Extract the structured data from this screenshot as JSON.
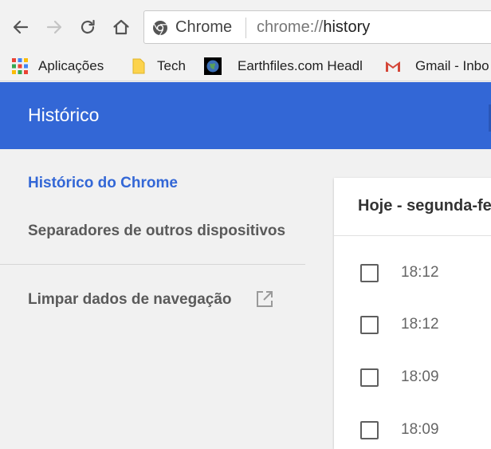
{
  "toolbar": {
    "back_icon": "arrow-left-icon",
    "forward_icon": "arrow-right-icon",
    "reload_icon": "reload-icon",
    "home_icon": "home-icon",
    "omnibox": {
      "site_chip": "Chrome",
      "url_scheme": "chrome://",
      "url_host": "history"
    }
  },
  "bookmarks": {
    "items": [
      {
        "label": "Aplicações",
        "icon": "apps-grid-icon"
      },
      {
        "label": "Tech",
        "icon": "folder-icon"
      },
      {
        "label": "Earthfiles.com Headl",
        "icon": "earth-icon"
      },
      {
        "label": "Gmail - Inbo",
        "icon": "gmail-icon"
      }
    ]
  },
  "header": {
    "title": "Histórico"
  },
  "sidebar": {
    "items": [
      {
        "label": "Histórico do Chrome",
        "active": true
      },
      {
        "label": "Separadores de outros dispositivos",
        "active": false
      },
      {
        "label": "Limpar dados de navegação",
        "active": false
      }
    ]
  },
  "history": {
    "date_heading": "Hoje - segunda-fe",
    "entries": [
      {
        "time": "18:12",
        "checked": false
      },
      {
        "time": "18:12",
        "checked": false
      },
      {
        "time": "18:09",
        "checked": false
      },
      {
        "time": "18:09",
        "checked": false
      }
    ]
  },
  "colors": {
    "header_bg": "#3367d6",
    "active_link": "#3367d6",
    "page_bg": "#f1f1f1"
  }
}
